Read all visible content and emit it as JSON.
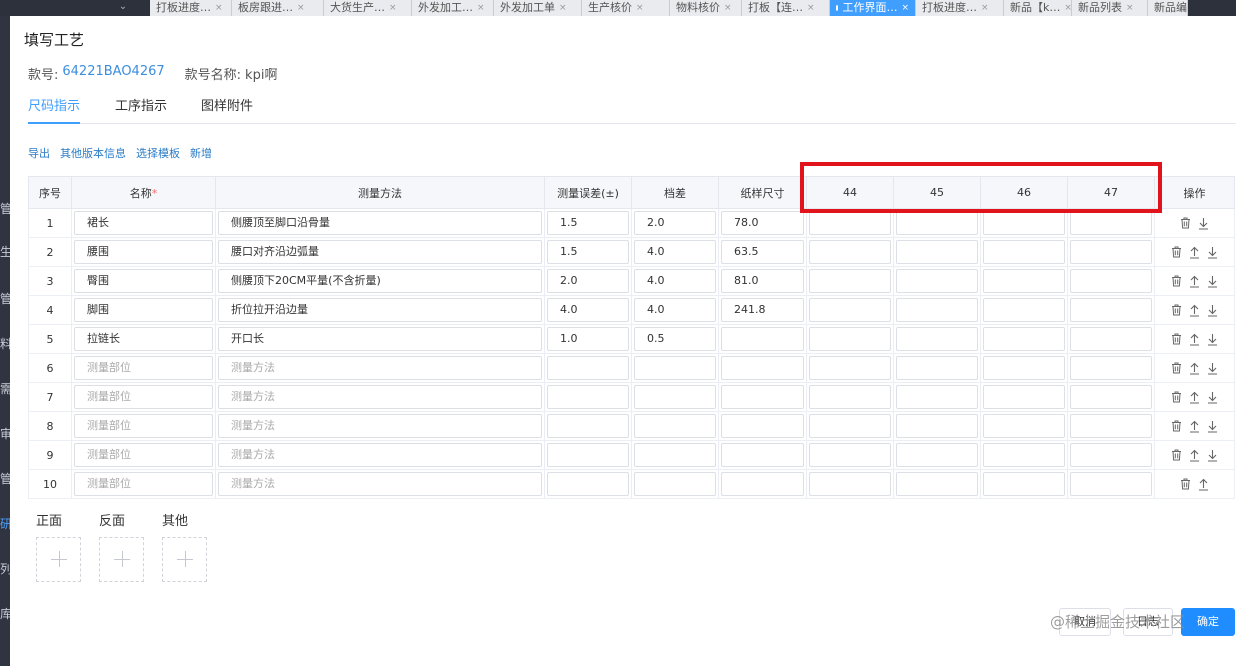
{
  "background": {
    "sidebar_items": [
      {
        "label": "管",
        "active": false
      },
      {
        "label": "生",
        "active": false
      },
      {
        "label": "管",
        "active": false
      },
      {
        "label": "料",
        "active": false
      },
      {
        "label": "需",
        "active": false
      },
      {
        "label": "审",
        "active": false
      },
      {
        "label": "管",
        "active": false
      },
      {
        "label": "研",
        "active": true
      },
      {
        "label": "列",
        "active": false
      },
      {
        "label": "库",
        "active": false
      }
    ],
    "tabs": [
      {
        "label": "打板进度…",
        "active": false
      },
      {
        "label": "板房跟进…",
        "active": false
      },
      {
        "label": "大货生产…",
        "active": false
      },
      {
        "label": "外发加工…",
        "active": false
      },
      {
        "label": "外发加工单",
        "active": false
      },
      {
        "label": "生产核价",
        "active": false
      },
      {
        "label": "物料核价",
        "active": false
      },
      {
        "label": "打板【连…",
        "active": false
      },
      {
        "label": "工作界面…",
        "active": true
      },
      {
        "label": "打板进度…",
        "active": false
      },
      {
        "label": "新品【k…",
        "active": false
      },
      {
        "label": "新品列表",
        "active": false
      },
      {
        "label": "新品编",
        "active": false
      }
    ]
  },
  "dialog": {
    "title": "填写工艺",
    "style_no_label": "款号:",
    "style_no": "64221BAO4267",
    "style_name_label": "款号名称:",
    "style_name": "kpi啊"
  },
  "tabs": [
    {
      "label": "尺码指示",
      "active": true
    },
    {
      "label": "工序指示",
      "active": false
    },
    {
      "label": "图样附件",
      "active": false
    }
  ],
  "actions": [
    "导出",
    "其他版本信息",
    "选择模板",
    "新增"
  ],
  "table": {
    "headers": {
      "index": "序号",
      "name": "名称",
      "required_mark": "*",
      "method": "测量方法",
      "tolerance": "测量误差(±)",
      "grade": "档差",
      "sample": "纸样尺寸",
      "sizes": [
        "44",
        "45",
        "46",
        "47"
      ],
      "ops": "操作"
    },
    "placeholders": {
      "name": "测量部位",
      "method": "测量方法"
    },
    "rows": [
      {
        "index": "1",
        "name": "裙长",
        "method": "侧腰顶至脚口沿骨量",
        "tolerance": "1.5",
        "grade": "2.0",
        "sample": "78.0",
        "ops": [
          "delete",
          "down"
        ]
      },
      {
        "index": "2",
        "name": "腰围",
        "method": "腰口对齐沿边弧量",
        "tolerance": "1.5",
        "grade": "4.0",
        "sample": "63.5",
        "ops": [
          "delete",
          "up",
          "down"
        ]
      },
      {
        "index": "3",
        "name": "臀围",
        "method": "侧腰顶下20CM平量(不含折量)",
        "tolerance": "2.0",
        "grade": "4.0",
        "sample": "81.0",
        "ops": [
          "delete",
          "up",
          "down"
        ]
      },
      {
        "index": "4",
        "name": "脚围",
        "method": "折位拉开沿边量",
        "tolerance": "4.0",
        "grade": "4.0",
        "sample": "241.8",
        "ops": [
          "delete",
          "up",
          "down"
        ]
      },
      {
        "index": "5",
        "name": "拉链长",
        "method": "开口长",
        "tolerance": "1.0",
        "grade": "0.5",
        "sample": "",
        "ops": [
          "delete",
          "up",
          "down"
        ]
      },
      {
        "index": "6",
        "name": "",
        "method": "",
        "tolerance": "",
        "grade": "",
        "sample": "",
        "ops": [
          "delete",
          "up",
          "down"
        ]
      },
      {
        "index": "7",
        "name": "",
        "method": "",
        "tolerance": "",
        "grade": "",
        "sample": "",
        "ops": [
          "delete",
          "up",
          "down"
        ]
      },
      {
        "index": "8",
        "name": "",
        "method": "",
        "tolerance": "",
        "grade": "",
        "sample": "",
        "ops": [
          "delete",
          "up",
          "down"
        ]
      },
      {
        "index": "9",
        "name": "",
        "method": "",
        "tolerance": "",
        "grade": "",
        "sample": "",
        "ops": [
          "delete",
          "up",
          "down"
        ]
      },
      {
        "index": "10",
        "name": "",
        "method": "",
        "tolerance": "",
        "grade": "",
        "sample": "",
        "ops": [
          "delete",
          "up"
        ]
      }
    ]
  },
  "uploads": [
    "正面",
    "反面",
    "其他"
  ],
  "footer": {
    "cancel": "取消",
    "log": "日志",
    "confirm": "确定"
  },
  "watermark": "@稀土掘金技术社区",
  "colors": {
    "primary": "#409eff",
    "highlight": "#e0141a",
    "link": "#2b7cc6"
  }
}
